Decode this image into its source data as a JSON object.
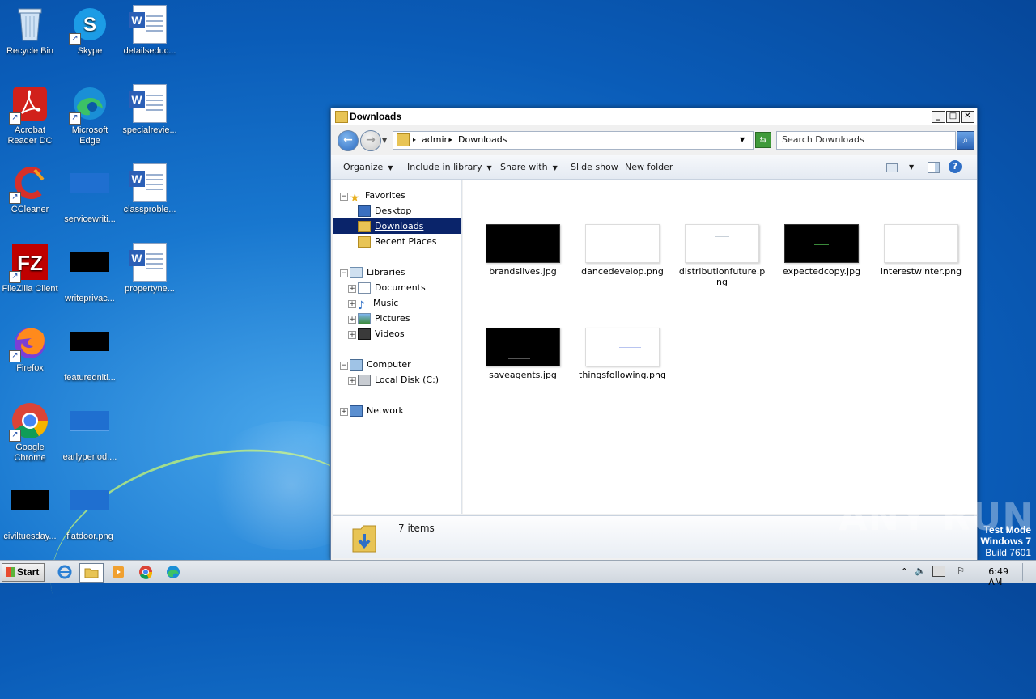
{
  "desktop": {
    "icons": [
      {
        "label": "Recycle Bin"
      },
      {
        "label": "Skype"
      },
      {
        "label": "detailseduc..."
      },
      {
        "label": "Acrobat Reader DC"
      },
      {
        "label": "Microsoft Edge"
      },
      {
        "label": "specialrevie..."
      },
      {
        "label": "CCleaner"
      },
      {
        "label": "servicewriti..."
      },
      {
        "label": "classproble..."
      },
      {
        "label": "FileZilla Client"
      },
      {
        "label": "writeprivac..."
      },
      {
        "label": "propertyne..."
      },
      {
        "label": "Firefox"
      },
      {
        "label": "featuredniti..."
      },
      {
        "label": "Google Chrome"
      },
      {
        "label": "earlyperiod...."
      },
      {
        "label": "civiltuesday..."
      },
      {
        "label": "flatdoor.png"
      }
    ]
  },
  "window": {
    "title": "Downloads",
    "buttons": {
      "minimize": "_",
      "maximize": "□",
      "close": "✕"
    },
    "address": {
      "segments": [
        "admin",
        "Downloads"
      ]
    },
    "search_placeholder": "Search Downloads",
    "toolbar": {
      "organize": "Organize",
      "include": "Include in library",
      "share": "Share with",
      "slideshow": "Slide show",
      "new_folder": "New folder"
    },
    "nav": {
      "favorites": "Favorites",
      "desktop": "Desktop",
      "downloads": "Downloads",
      "recent": "Recent Places",
      "libraries": "Libraries",
      "documents": "Documents",
      "music": "Music",
      "pictures": "Pictures",
      "videos": "Videos",
      "computer": "Computer",
      "local_disk": "Local Disk (C:)",
      "network": "Network"
    },
    "files": [
      {
        "name": "brandslives.jpg",
        "thumb": "dark"
      },
      {
        "name": "dancedevelop.png",
        "thumb": "light"
      },
      {
        "name": "distributionfuture.png",
        "name_line1": "distributionfuture.p",
        "name_line2": "ng",
        "thumb": "light"
      },
      {
        "name": "expectedcopy.jpg",
        "thumb": "dark"
      },
      {
        "name": "interestwinter.png",
        "thumb": "light"
      },
      {
        "name": "saveagents.jpg",
        "thumb": "dark"
      },
      {
        "name": "thingsfollowing.png",
        "thumb": "light"
      }
    ],
    "status": {
      "count": "7 items"
    }
  },
  "watermark": {
    "brand": "ANY RUN",
    "line1": "Test Mode",
    "line2": "Windows 7",
    "line3": "Build 7601"
  },
  "taskbar": {
    "start": "Start",
    "time": "6:49 AM"
  },
  "colors": {
    "desktop": "#0a5cb8",
    "selection": "#0a246a",
    "window_border": "#5c7da7"
  }
}
